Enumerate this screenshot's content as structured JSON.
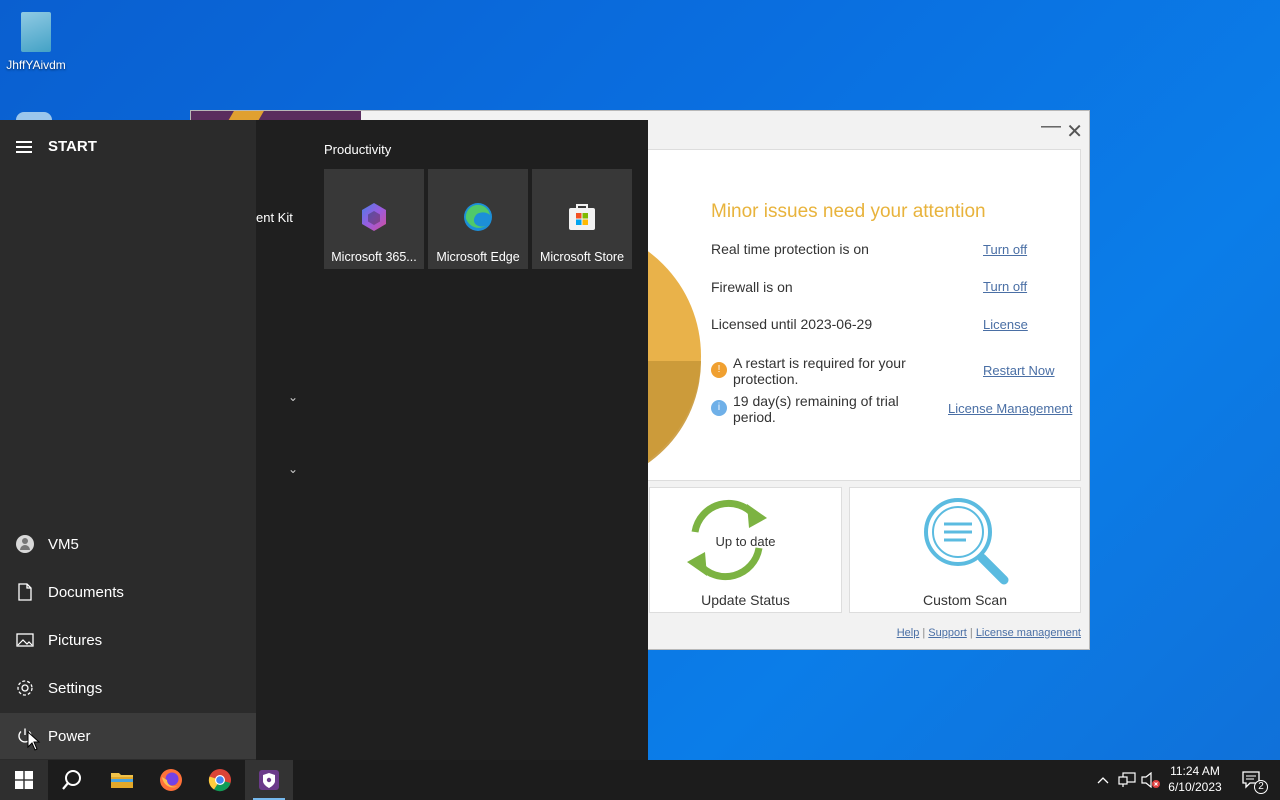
{
  "desktop": {
    "icons": [
      {
        "label": "JhffYAivdm"
      }
    ]
  },
  "antivirus": {
    "status_title": "Minor issues need your attention",
    "rows": [
      {
        "text": "Real time protection is on",
        "link": "Turn off"
      },
      {
        "text": "Firewall is on",
        "link": "Turn off"
      },
      {
        "text": "Licensed until 2023-06-29",
        "link": "License"
      }
    ],
    "notices": [
      {
        "text": "A restart is required for your protection.",
        "link": "Restart Now",
        "badge": "!"
      },
      {
        "text": "19 day(s) remaining of trial period.",
        "link": "License Management",
        "badge": "i"
      }
    ],
    "tiles": [
      {
        "label": "Update Status",
        "inner": "Up to date"
      },
      {
        "label": "Custom Scan"
      }
    ],
    "footer": {
      "help": "Help",
      "support": "Support",
      "license": "License management",
      "sep": "|"
    },
    "colors": {
      "warning": "#e8b33c",
      "link": "#4a6fa5",
      "update_green": "#7cb342",
      "scan_blue": "#5bbbe0"
    }
  },
  "start_menu": {
    "header": "START",
    "app_list_fragment": "ent Kit",
    "left_items": [
      {
        "label": "VM5",
        "icon": "user-avatar-icon"
      },
      {
        "label": "Documents",
        "icon": "document-icon"
      },
      {
        "label": "Pictures",
        "icon": "pictures-icon"
      },
      {
        "label": "Settings",
        "icon": "gear-icon"
      },
      {
        "label": "Power",
        "icon": "power-icon"
      }
    ],
    "group_title": "Productivity",
    "tiles": [
      {
        "label": "Microsoft 365...",
        "icon": "microsoft-365-icon"
      },
      {
        "label": "Microsoft Edge",
        "icon": "edge-icon"
      },
      {
        "label": "Microsoft Store",
        "icon": "store-icon"
      }
    ]
  },
  "taskbar": {
    "apps": [
      "start-icon",
      "search-icon",
      "file-explorer-icon",
      "firefox-icon",
      "chrome-icon",
      "antivirus-icon"
    ],
    "clock": {
      "time": "11:24 AM",
      "date": "6/10/2023"
    },
    "notifications_count": "2"
  }
}
